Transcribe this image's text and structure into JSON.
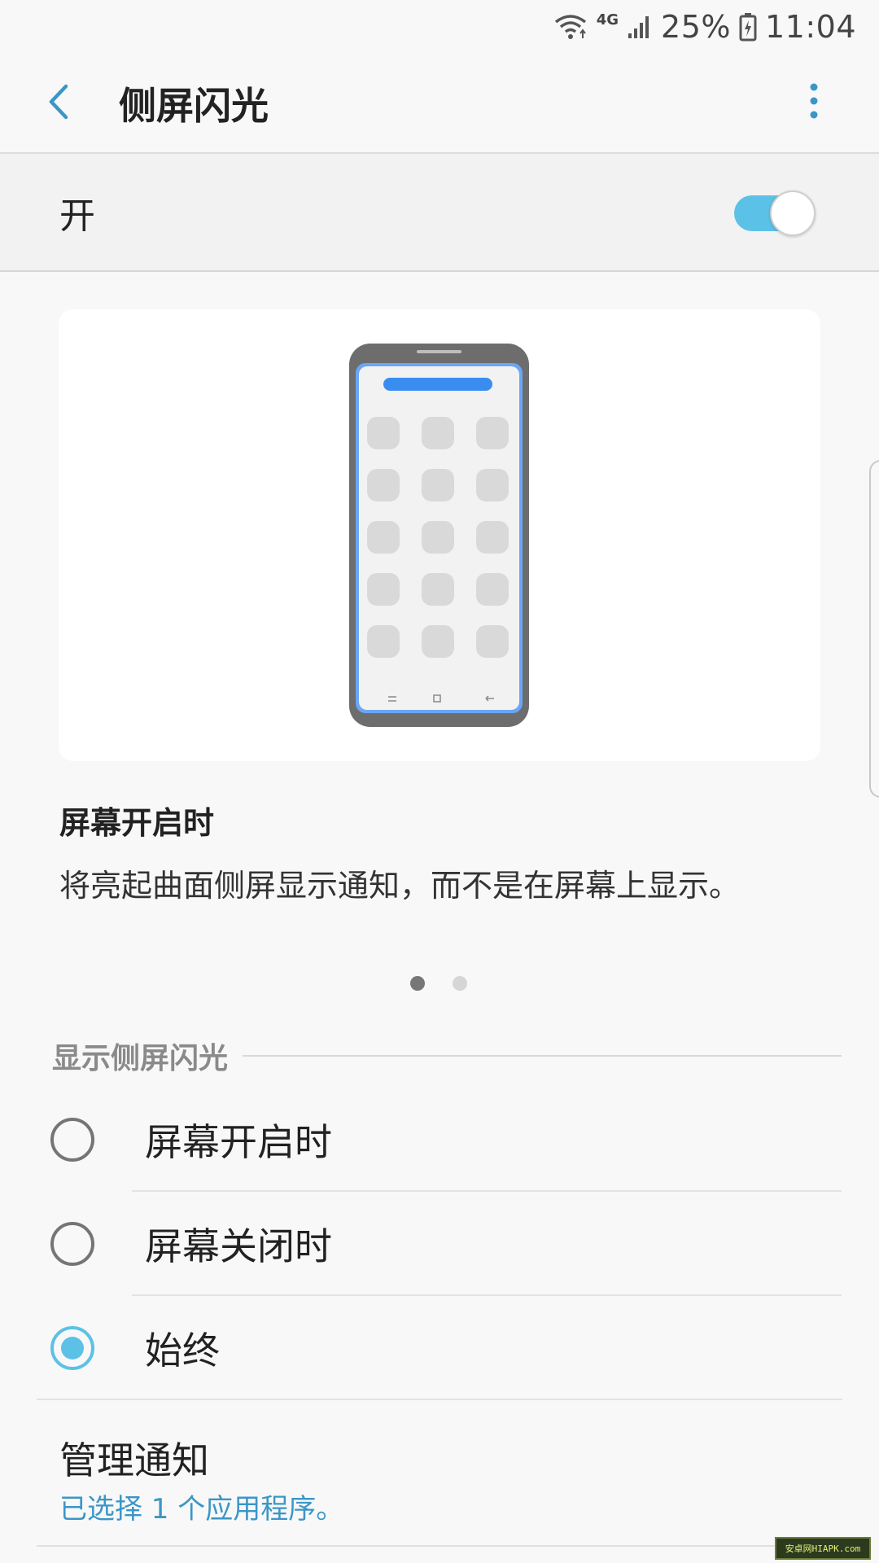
{
  "status_bar": {
    "network_type": "4G",
    "battery_percent": "25%",
    "time": "11:04"
  },
  "app_bar": {
    "title": "侧屏闪光"
  },
  "master_switch": {
    "label": "开",
    "on": true,
    "accent_color": "#5cc1e6"
  },
  "description": {
    "title": "屏幕开启时",
    "text": "将亮起曲面侧屏显示通知，而不是在屏幕上显示。"
  },
  "pager": {
    "page_count": 2,
    "current_page": 1
  },
  "section": {
    "header": "显示侧屏闪光",
    "options": [
      {
        "label": "屏幕开启时",
        "checked": false
      },
      {
        "label": "屏幕关闭时",
        "checked": false
      },
      {
        "label": "始终",
        "checked": true
      }
    ]
  },
  "manage": {
    "title": "管理通知",
    "subtitle": "已选择 1 个应用程序。"
  },
  "watermark": "安卓网HIAPK.com",
  "icons": [
    "wifi-icon",
    "signal-icon",
    "battery-icon",
    "back-arrow-icon",
    "more-vert-icon"
  ]
}
